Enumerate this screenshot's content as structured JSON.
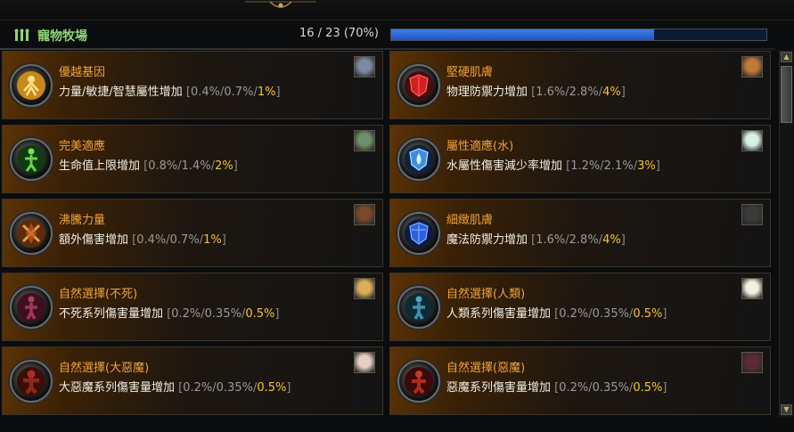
{
  "header": {
    "title": "寵物牧場",
    "progress_text": "16 / 23 (70%)",
    "progress_fraction": 0.7
  },
  "cards": [
    {
      "name": "優越基因",
      "desc": "力量/敏捷/智慧屬性增加",
      "v1": "0.4%",
      "v2": "0.7%",
      "v3": "1%",
      "icon": "gold-figure-icon",
      "pet": "gray-wolf-pet-icon"
    },
    {
      "name": "堅硬肌膚",
      "desc": "物理防禦力增加",
      "v1": "1.6%",
      "v2": "2.8%",
      "v3": "4%",
      "icon": "red-shield-icon",
      "pet": "fox-pet-icon"
    },
    {
      "name": "完美適應",
      "desc": "生命值上限增加",
      "v1": "0.8%",
      "v2": "1.4%",
      "v3": "2%",
      "icon": "green-figure-icon",
      "pet": "goblin-pet-icon"
    },
    {
      "name": "屬性適應(水)",
      "desc": "水屬性傷害減少率增加",
      "v1": "1.2%",
      "v2": "2.1%",
      "v3": "3%",
      "icon": "blue-water-shield-icon",
      "pet": "sprout-pet-icon"
    },
    {
      "name": "沸騰力量",
      "desc": "額外傷害增加",
      "v1": "0.4%",
      "v2": "0.7%",
      "v3": "1%",
      "icon": "crossed-swords-icon",
      "pet": "bear-pet-icon"
    },
    {
      "name": "細緻肌膚",
      "desc": "魔法防禦力增加",
      "v1": "1.6%",
      "v2": "2.8%",
      "v3": "4%",
      "icon": "blue-shield-icon",
      "pet": "panda-pet-icon"
    },
    {
      "name": "自然選擇(不死)",
      "desc": "不死系列傷害量增加",
      "v1": "0.2%",
      "v2": "0.35%",
      "v3": "0.5%",
      "icon": "undead-figure-icon",
      "pet": "lion-pet-icon"
    },
    {
      "name": "自然選擇(人類)",
      "desc": "人類系列傷害量增加",
      "v1": "0.2%",
      "v2": "0.35%",
      "v3": "0.5%",
      "icon": "human-figure-icon",
      "pet": "white-dog-pet-icon"
    },
    {
      "name": "自然選擇(大惡魔)",
      "desc": "大惡魔系列傷害量增加",
      "v1": "0.2%",
      "v2": "0.35%",
      "v3": "0.5%",
      "icon": "archdemon-figure-icon",
      "pet": "girl-pet-icon"
    },
    {
      "name": "自然選擇(惡魔)",
      "desc": "惡魔系列傷害量增加",
      "v1": "0.2%",
      "v2": "0.35%",
      "v3": "0.5%",
      "icon": "demon-figure-icon",
      "pet": "dark-girl-pet-icon"
    }
  ],
  "colors": {
    "title_green": "#8ed37a",
    "name_orange": "#f0a33a",
    "value_gold": "#f4c530",
    "progress_blue": "#2f6fdc"
  }
}
